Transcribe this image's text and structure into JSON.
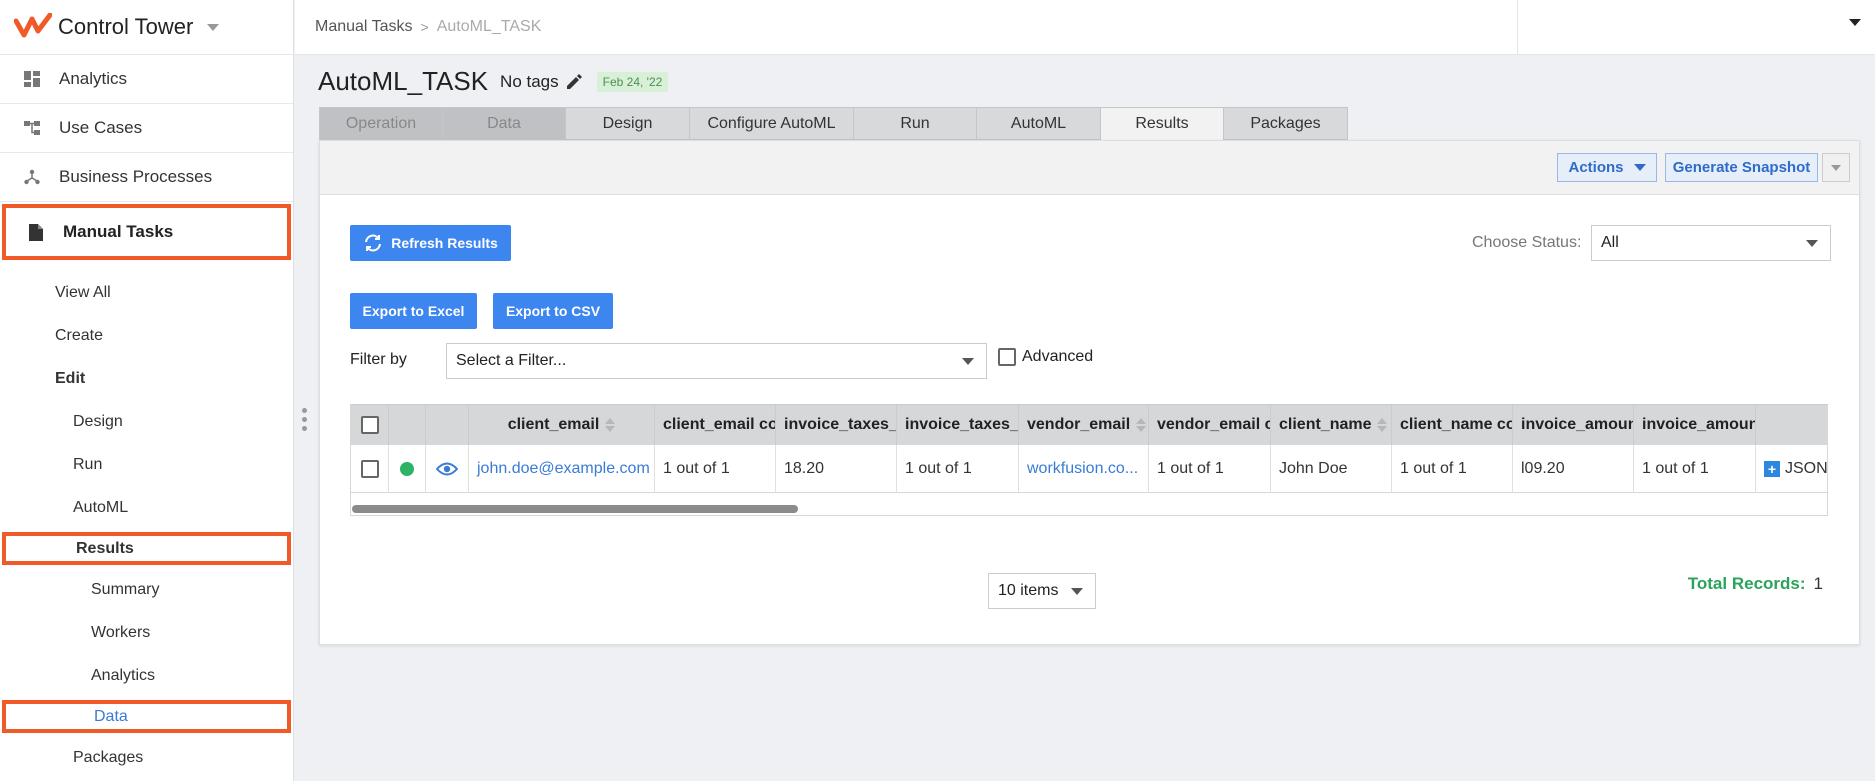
{
  "app": {
    "title": "Control Tower"
  },
  "sidebar": {
    "nav": [
      {
        "label": "Analytics",
        "icon": "dashboard-icon"
      },
      {
        "label": "Use Cases",
        "icon": "hierarchy-icon"
      },
      {
        "label": "Business Processes",
        "icon": "process-icon"
      },
      {
        "label": "Manual Tasks",
        "icon": "document-icon",
        "active": true
      }
    ],
    "sub": {
      "view_all": "View All",
      "create": "Create",
      "edit": "Edit",
      "design": "Design",
      "run": "Run",
      "automl": "AutoML",
      "results": "Results",
      "summary": "Summary",
      "workers": "Workers",
      "analytics": "Analytics",
      "data": "Data",
      "packages": "Packages"
    }
  },
  "breadcrumb": {
    "parent": "Manual Tasks",
    "current": "AutoML_TASK"
  },
  "header": {
    "title": "AutoML_TASK",
    "tags": "No tags",
    "date": "Feb 24, '22"
  },
  "tabs": [
    "Operation",
    "Data",
    "Design",
    "Configure AutoML",
    "Run",
    "AutoML",
    "Results",
    "Packages"
  ],
  "toolbar": {
    "actions": "Actions",
    "snapshot": "Generate Snapshot"
  },
  "controls": {
    "refresh": "Refresh Results",
    "export_excel": "Export to Excel",
    "export_csv": "Export to CSV",
    "status_label": "Choose Status:",
    "status_value": "All",
    "filter_label": "Filter by",
    "filter_placeholder": "Select a Filter...",
    "advanced": "Advanced"
  },
  "table": {
    "headers": [
      "client_email",
      "client_email con",
      "invoice_taxes_ar",
      "invoice_taxes_ar",
      "vendor_email",
      "vendor_email co",
      "client_name",
      "client_name con",
      "invoice_amount",
      "invoice_amount"
    ],
    "row": [
      "john.doe@example.com",
      "1 out of 1",
      "18.20",
      "1 out of 1",
      "workfusion.co...",
      "1 out of 1",
      "John Doe",
      "1 out of 1",
      "l09.20",
      "1 out of 1"
    ],
    "json_label": "JSON"
  },
  "pagination": {
    "items": "10 items"
  },
  "totals": {
    "label": "Total Records:",
    "value": "1"
  },
  "colors": {
    "accent": "#3d86f0",
    "highlight": "#f05a28",
    "success": "#2db266"
  }
}
